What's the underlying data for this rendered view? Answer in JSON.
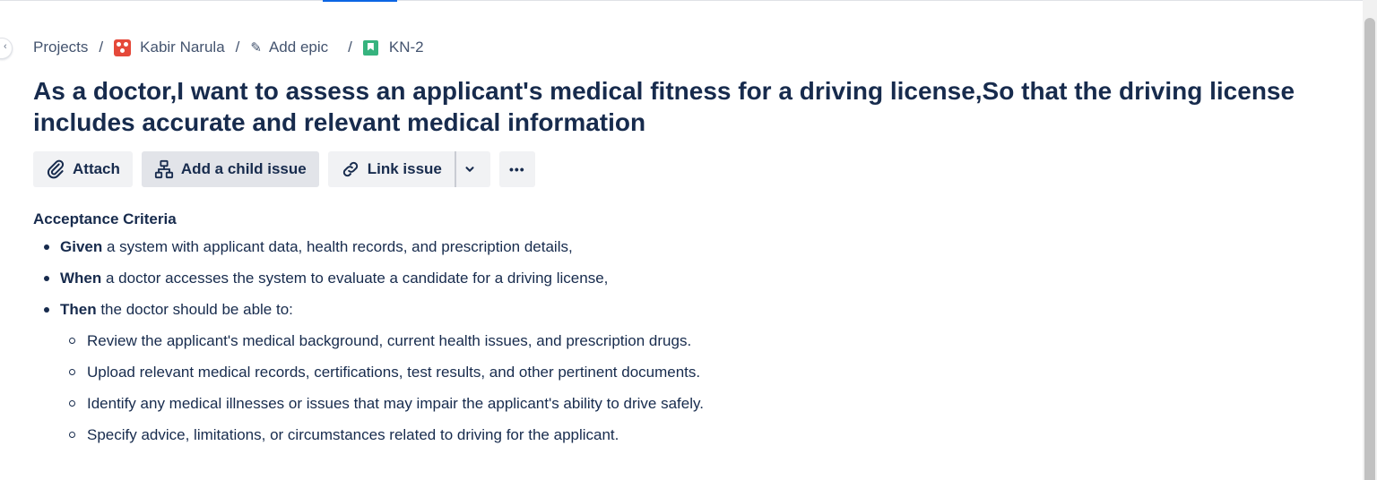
{
  "breadcrumb": {
    "projects": "Projects",
    "project_name": "Kabir Narula",
    "epic": "Add epic",
    "issue_key": "KN-2",
    "separator": "/"
  },
  "issue": {
    "title": "As a doctor,I want to assess an applicant's medical fitness for a driving license,So that the driving license includes accurate and relevant medical information"
  },
  "toolbar": {
    "attach": "Attach",
    "add_child": "Add a child issue",
    "link_issue": "Link issue",
    "more": "•••"
  },
  "description": {
    "heading": "Acceptance Criteria",
    "given_kw": "Given",
    "given_text": " a system with applicant data, health records, and prescription details,",
    "when_kw": "When",
    "when_text": " a doctor accesses the system to evaluate a candidate for a driving license,",
    "then_kw": "Then",
    "then_text": " the doctor should be able to:",
    "sub_items": [
      "Review the applicant's medical background, current health issues, and prescription drugs.",
      "Upload relevant medical records, certifications, test results, and other pertinent documents.",
      "Identify any medical illnesses or issues that may impair the applicant's ability to drive safely.",
      "Specify advice, limitations, or circumstances related to driving for the applicant."
    ]
  },
  "icons": [
    "chevron-left-icon",
    "project-avatar-icon",
    "pencil-icon",
    "story-icon",
    "paperclip-icon",
    "hierarchy-icon",
    "link-icon",
    "chevron-down-icon",
    "more-icon"
  ],
  "colors": {
    "text": "#172b4d",
    "button_bg": "#f1f2f4",
    "story_green": "#36b37e",
    "project_red": "#e5493a",
    "accent": "#0c66e4"
  }
}
